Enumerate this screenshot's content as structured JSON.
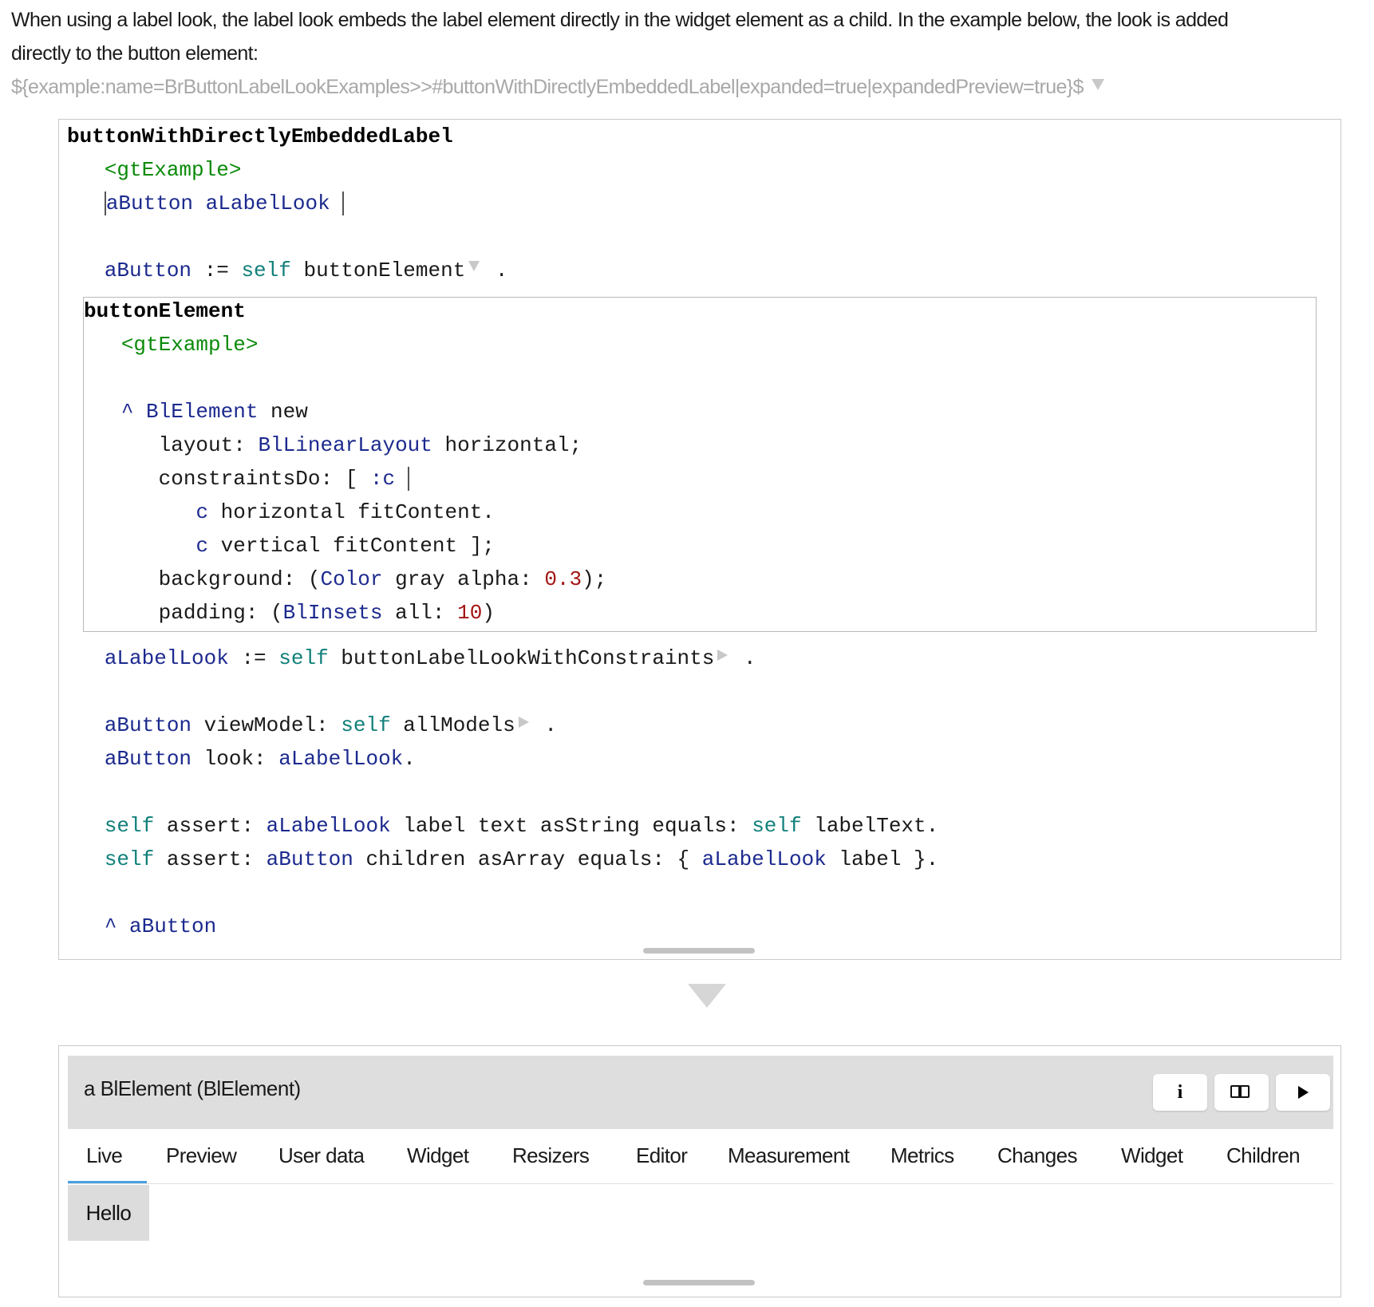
{
  "intro": {
    "text_line1": "When using a label look, the label look embeds the label element directly in the widget element as a child. In the example below, the look is added",
    "text_line2": "directly to the button element:",
    "reference": "${example:name=BrButtonLabelLookExamples>>#buttonWithDirectlyEmbeddedLabel|expanded=true|expandedPreview=true}$"
  },
  "outer_code": {
    "selector": "buttonWithDirectlyEmbeddedLabel",
    "pragma": "<gtExample>",
    "temps_open": "|",
    "temp1": "aButton",
    "temp2": "aLabelLook",
    "l4_var": "aButton",
    "l4_assign": " := ",
    "l4_self": "self",
    "l4_msg": " buttonElement",
    "l4_end": " .",
    "l_look_var": "aLabelLook",
    "l_look_assign": " := ",
    "l_look_self": "self",
    "l_look_msg": " buttonLabelLookWithConstraints",
    "l_look_end": " .",
    "vm_var": "aButton",
    "vm_msg": " viewModel: ",
    "vm_self": "self",
    "vm_arg": " allModels",
    "vm_end": " .",
    "lk_var": "aButton",
    "lk_msg": " look: ",
    "lk_arg": "aLabelLook",
    "lk_end": ".",
    "a1_self": "self",
    "a1_msg": " assert: ",
    "a1_var": "aLabelLook",
    "a1_rest": " label text asString equals: ",
    "a1_self2": "self",
    "a1_end": " labelText.",
    "a2_self": "self",
    "a2_msg": " assert: ",
    "a2_var": "aButton",
    "a2_rest": " children asArray equals: { ",
    "a2_var2": "aLabelLook",
    "a2_end": " label }.",
    "ret_caret": "^",
    "ret_var": " aButton"
  },
  "inner_code": {
    "selector": "buttonElement",
    "pragma": "<gtExample>",
    "ret_caret": "^",
    "cls1": " BlElement",
    "new_msg": " new",
    "layout_kw": "layout: ",
    "cls2": "BlLinearLayout",
    "layout_end": " horizontal;",
    "cdo_kw": "constraintsDo: [ ",
    "cdo_arg": ":c",
    "c_var1": "c",
    "c1_rest": " horizontal fitContent.",
    "c_var2": "c",
    "c2_rest": " vertical fitContent ];",
    "bg_kw": "background: (",
    "cls3": "Color",
    "bg_mid": " gray alpha: ",
    "bg_num": "0.3",
    "bg_end": ");",
    "pad_kw": "padding: (",
    "cls4": "BlInsets",
    "pad_mid": " all: ",
    "pad_num": "10",
    "pad_end": ")"
  },
  "inspector": {
    "title": "a BlElement (BlElement)",
    "buttons": [
      {
        "icon": "info-icon",
        "glyph": "i"
      },
      {
        "icon": "book-icon"
      },
      {
        "icon": "play-icon"
      }
    ],
    "tabs": [
      "Live",
      "Preview",
      "User data",
      "Widget",
      "Resizers",
      "Editor",
      "Measurement",
      "Metrics",
      "Changes",
      "Widget",
      "Children"
    ],
    "active_tab": "Live",
    "preview_label": "Hello"
  },
  "colors": {
    "pragma": "#0a8a0a",
    "variable": "#1c2a8e",
    "self": "#11807a",
    "number": "#a31515",
    "tab_underline": "#4aa0e0"
  }
}
